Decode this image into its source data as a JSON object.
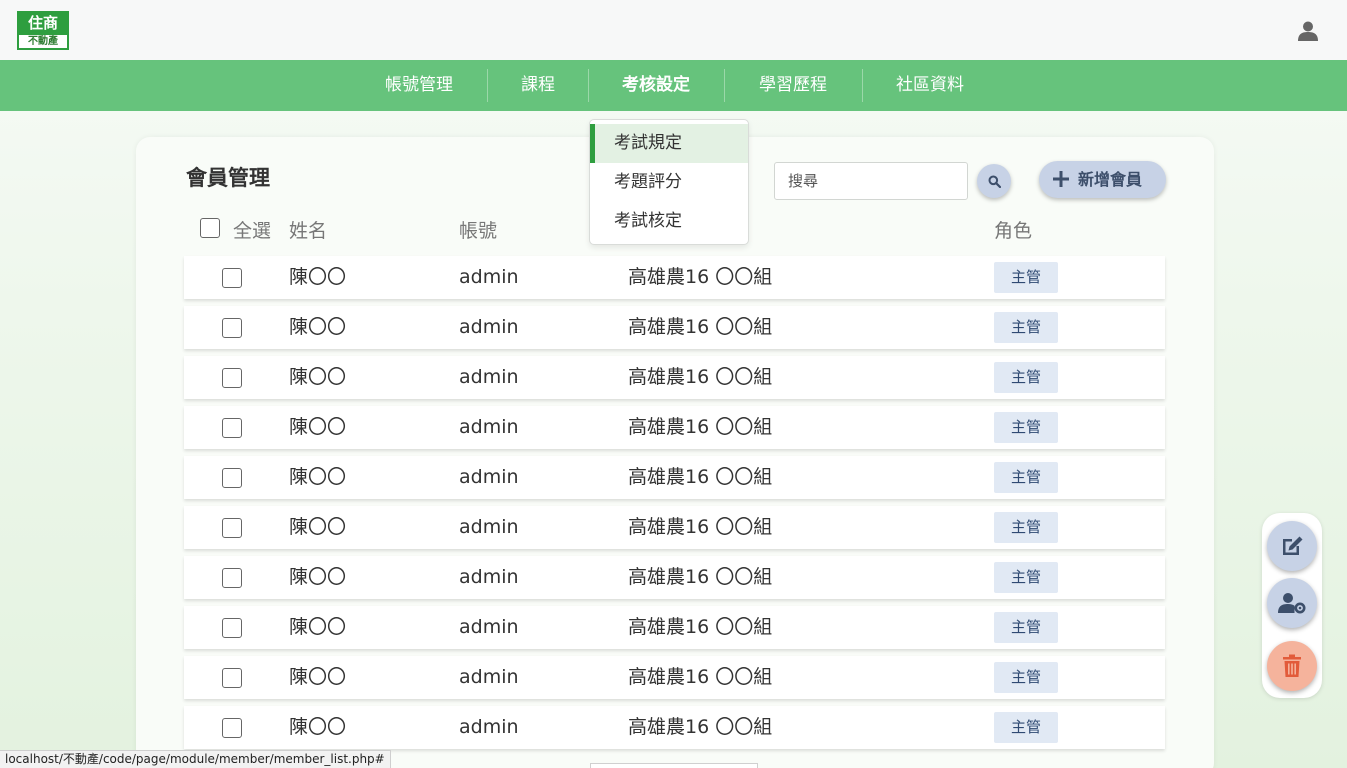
{
  "logo": {
    "top": "住商",
    "bottom": "不動產"
  },
  "nav": {
    "items": [
      {
        "label": "帳號管理"
      },
      {
        "label": "課程"
      },
      {
        "label": "考核設定"
      },
      {
        "label": "學習歷程"
      },
      {
        "label": "社區資料"
      }
    ],
    "active": "考核設定"
  },
  "dropdown": {
    "items": [
      {
        "label": "考試規定"
      },
      {
        "label": "考題評分"
      },
      {
        "label": "考試核定"
      }
    ],
    "active": "考試規定"
  },
  "page": {
    "title": "會員管理",
    "search_placeholder": "搜尋",
    "add_label": "新增會員"
  },
  "table": {
    "headers": {
      "select_all": "全選",
      "name": "姓名",
      "account": "帳號",
      "role": "角色"
    },
    "rows": [
      {
        "name": "陳〇〇",
        "account": "admin",
        "group": "高雄農16 〇〇組",
        "role": "主管"
      },
      {
        "name": "陳〇〇",
        "account": "admin",
        "group": "高雄農16 〇〇組",
        "role": "主管"
      },
      {
        "name": "陳〇〇",
        "account": "admin",
        "group": "高雄農16 〇〇組",
        "role": "主管"
      },
      {
        "name": "陳〇〇",
        "account": "admin",
        "group": "高雄農16 〇〇組",
        "role": "主管"
      },
      {
        "name": "陳〇〇",
        "account": "admin",
        "group": "高雄農16 〇〇組",
        "role": "主管"
      },
      {
        "name": "陳〇〇",
        "account": "admin",
        "group": "高雄農16 〇〇組",
        "role": "主管"
      },
      {
        "name": "陳〇〇",
        "account": "admin",
        "group": "高雄農16 〇〇組",
        "role": "主管"
      },
      {
        "name": "陳〇〇",
        "account": "admin",
        "group": "高雄農16 〇〇組",
        "role": "主管"
      },
      {
        "name": "陳〇〇",
        "account": "admin",
        "group": "高雄農16 〇〇組",
        "role": "主管"
      },
      {
        "name": "陳〇〇",
        "account": "admin",
        "group": "高雄農16 〇〇組",
        "role": "主管"
      }
    ]
  },
  "side_toolbar": {
    "icons": [
      "edit-icon",
      "user-settings-icon",
      "trash-icon"
    ]
  },
  "status_bar": {
    "url": "localhost/不動產/code/page/module/member/member_list.php#"
  },
  "colors": {
    "nav_green": "#66c37c",
    "brand_green": "#2e9e3f",
    "button_blue": "#c7d2e6",
    "delete_orange": "#f5b39c"
  }
}
